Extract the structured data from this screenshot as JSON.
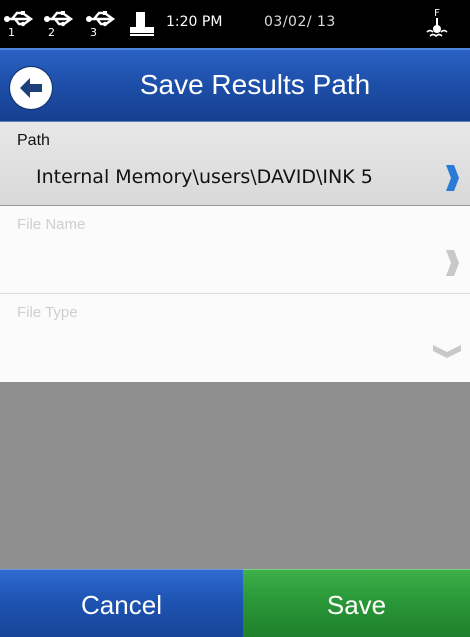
{
  "status_bar": {
    "usb_ports": [
      "1",
      "2",
      "3"
    ],
    "time": "1:20 PM",
    "date": "03/02/ 13",
    "fill_indicator": "F",
    "icons": [
      "usb-icon",
      "printer-icon",
      "ink-fill-icon"
    ]
  },
  "header": {
    "title": "Save Results Path",
    "back_icon": "back-arrow-icon"
  },
  "form": {
    "path": {
      "label": "Path",
      "value": "Internal Memory\\users\\DAVID\\INK 5"
    },
    "file_name": {
      "label": "File Name",
      "value": ""
    },
    "file_type": {
      "label": "File Type",
      "value": ""
    }
  },
  "footer": {
    "cancel_label": "Cancel",
    "save_label": "Save"
  },
  "colors": {
    "title_bar": "#1d4ea8",
    "cancel_button": "#1e54b3",
    "save_button": "#2a9838",
    "chevron_active": "#2a7ad6",
    "chevron_disabled": "#c8c8c8"
  }
}
